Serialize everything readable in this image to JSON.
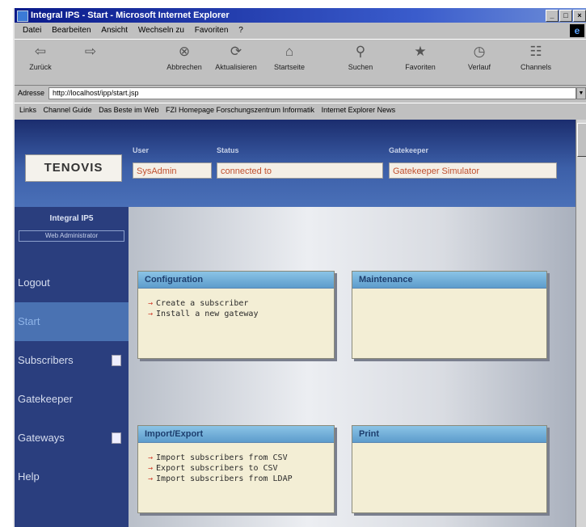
{
  "window": {
    "title": "Integral IPS - Start - Microsoft Internet Explorer",
    "controls": [
      "_",
      "□",
      "×"
    ]
  },
  "menu": [
    "Datei",
    "Bearbeiten",
    "Ansicht",
    "Wechseln zu",
    "Favoriten",
    "?"
  ],
  "toolbar": [
    {
      "label": "Zurück",
      "icon": "back-arrow-icon",
      "glyph": "⇦"
    },
    {
      "label": "",
      "icon": "forward-arrow-icon",
      "glyph": "⇨"
    },
    {
      "label": "Abbrechen",
      "icon": "stop-icon",
      "glyph": "⊗"
    },
    {
      "label": "Aktualisieren",
      "icon": "refresh-icon",
      "glyph": "⟳"
    },
    {
      "label": "Startseite",
      "icon": "home-icon",
      "glyph": "⌂"
    },
    {
      "label": "Suchen",
      "icon": "search-icon",
      "glyph": "⚲"
    },
    {
      "label": "Favoriten",
      "icon": "favorites-icon",
      "glyph": "★"
    },
    {
      "label": "Verlauf",
      "icon": "history-icon",
      "glyph": "◷"
    },
    {
      "label": "Channels",
      "icon": "channels-icon",
      "glyph": "☷"
    }
  ],
  "address": {
    "label": "Adresse",
    "url": "http://localhost/ipp/start.jsp"
  },
  "links": {
    "label": "Links",
    "items": [
      "Channel Guide",
      "Das Beste im Web",
      "FZI Homepage Forschungszentrum Informatik",
      "Internet Explorer News"
    ]
  },
  "app": {
    "logo": "TENOVIS",
    "fields": {
      "user": {
        "label": "User",
        "value": "SysAdmin"
      },
      "status": {
        "label": "Status",
        "value": "connected to"
      },
      "gatekeeper": {
        "label": "Gatekeeper",
        "value": "Gatekeeper Simulator"
      }
    },
    "product": "Integral IP5",
    "webadmin": "Web Administrator",
    "nav": [
      {
        "label": "Logout",
        "active": false,
        "submenu": false
      },
      {
        "label": "Start",
        "active": true,
        "submenu": false
      },
      {
        "label": "Subscribers",
        "active": false,
        "submenu": true
      },
      {
        "label": "Gatekeeper",
        "active": false,
        "submenu": false
      },
      {
        "label": "Gateways",
        "active": false,
        "submenu": true
      },
      {
        "label": "Help",
        "active": false,
        "submenu": false
      }
    ],
    "cards": {
      "configuration": {
        "title": "Configuration",
        "items": [
          "Create a subscriber",
          "Install a new gateway"
        ]
      },
      "maintenance": {
        "title": "Maintenance",
        "items": []
      },
      "import_export": {
        "title": "Import/Export",
        "items": [
          "Import subscribers from CSV",
          "Export subscribers to CSV",
          "Import subscribers from LDAP"
        ]
      },
      "print": {
        "title": "Print",
        "items": []
      }
    }
  },
  "colors": {
    "accent_red": "#d0402f",
    "nav_bg": "#2a3e7e",
    "card_header": "#5d9ccc"
  }
}
